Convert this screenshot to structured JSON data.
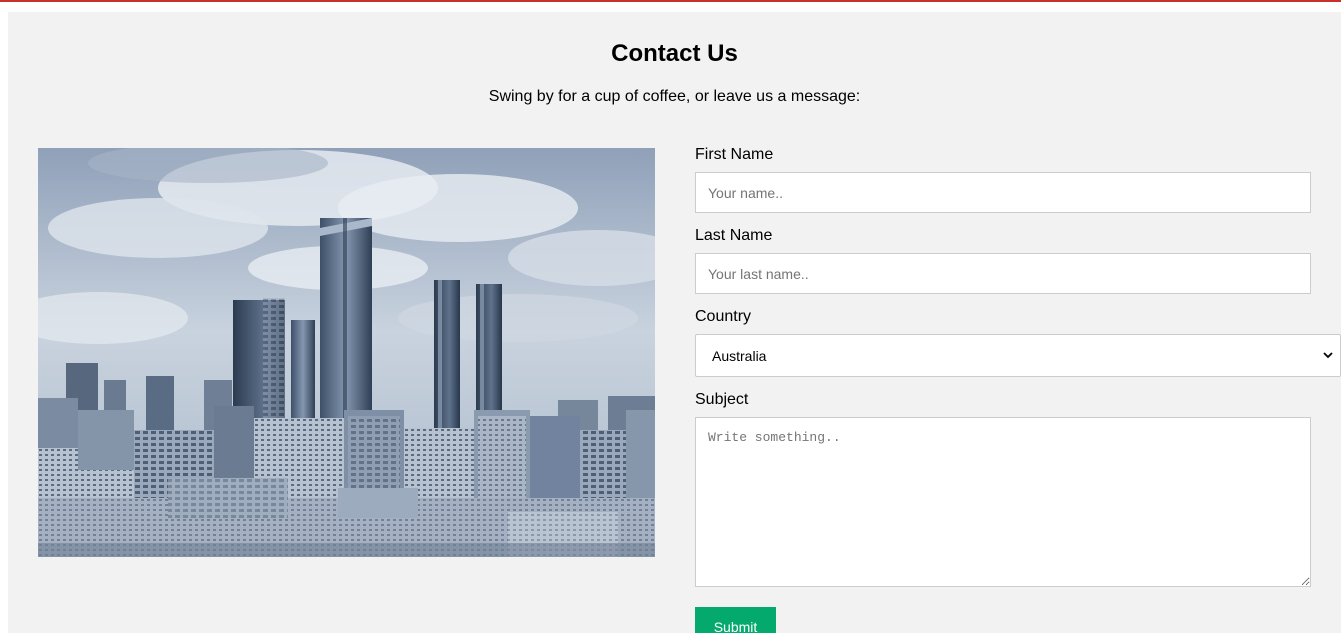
{
  "page": {
    "title": "Contact Us",
    "subtitle": "Swing by for a cup of coffee, or leave us a message:"
  },
  "hero_image": {
    "icon": "city-skyline-image"
  },
  "form": {
    "first_name": {
      "label": "First Name",
      "placeholder": "Your name.."
    },
    "last_name": {
      "label": "Last Name",
      "placeholder": "Your last name.."
    },
    "country": {
      "label": "Country",
      "selected": "Australia",
      "options": [
        "Australia"
      ]
    },
    "subject": {
      "label": "Subject",
      "placeholder": "Write something.."
    },
    "submit_label": "Submit"
  },
  "colors": {
    "accent_top_rule": "#c9302c",
    "submit_button": "#04aa6d",
    "panel_background": "#f2f2f2"
  }
}
